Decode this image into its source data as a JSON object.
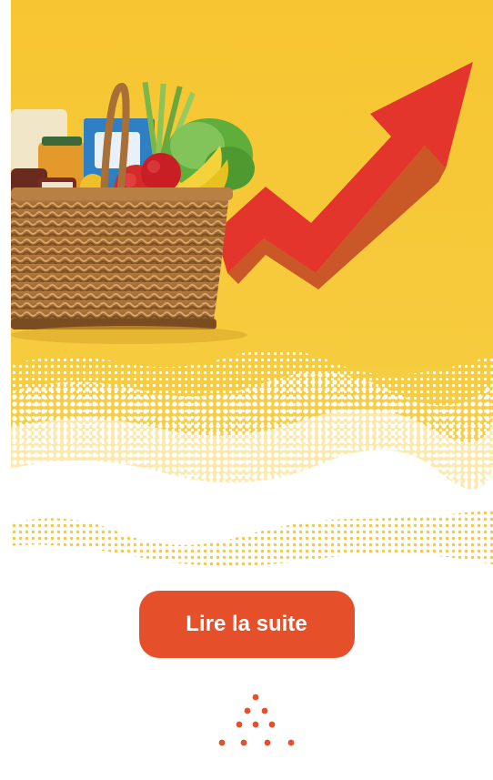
{
  "hero": {
    "icon": "grocery-basket-price-increase-image",
    "background_color": "#f6c93a",
    "arrow_color": "#e4352d"
  },
  "cta": {
    "label": "Lire la suite",
    "color": "#e5502a"
  },
  "decoration": {
    "icon": "dotted-triangle-icon",
    "color": "#e5502a"
  }
}
